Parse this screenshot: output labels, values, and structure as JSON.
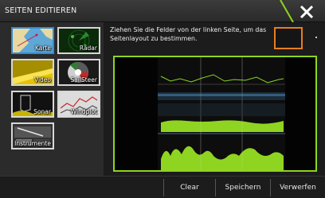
{
  "header": {
    "title": "SEITEN EDITIEREN",
    "close_icon": "close-x-icon",
    "accent_color": "#8fd420"
  },
  "tiles": [
    {
      "label": "Karte",
      "icon": "chart-map-icon",
      "selected": true
    },
    {
      "label": "Radar",
      "icon": "radar-icon",
      "selected": false
    },
    {
      "label": "Video",
      "icon": "video-icon",
      "selected": false
    },
    {
      "label": "SailSteer",
      "icon": "sailsteer-icon",
      "selected": false
    },
    {
      "label": "Sonar",
      "icon": "sonar-icon",
      "selected": false
    },
    {
      "label": "Windplot",
      "icon": "windplot-icon",
      "selected": false
    },
    {
      "label": "Instrumente",
      "icon": "instruments-icon",
      "selected": false
    }
  ],
  "main": {
    "instruction": "Ziehen Sie die Felder von der linken Seite, um das Seitenlayout zu bestimmen.",
    "layout_color": "#e67e22",
    "display_frame_color": "#8fd420"
  },
  "footer": {
    "clear": "Clear",
    "save": "Speichern",
    "discard": "Verwerfen"
  }
}
